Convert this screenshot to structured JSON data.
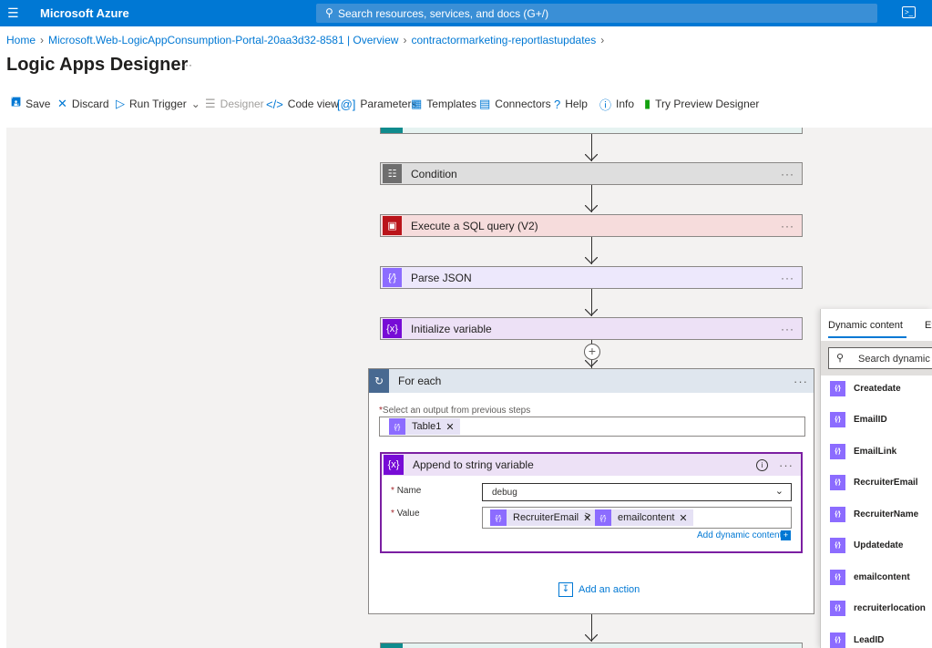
{
  "topbar": {
    "menu_icon": "hamburger-icon",
    "brand": "Microsoft Azure",
    "search_placeholder": "Search resources, services, and docs (G+/)",
    "cloud_shell_icon": "terminal-icon"
  },
  "breadcrumb": {
    "items": [
      "Home",
      "Microsoft.Web-LogicAppConsumption-Portal-20aa3d32-8581 | Overview",
      "contractormarketing-reportlastupdates"
    ]
  },
  "page": {
    "title": "Logic Apps Designer",
    "more": "···"
  },
  "toolbar": {
    "save": "Save",
    "discard": "Discard",
    "run_trigger": "Run Trigger",
    "designer": "Designer",
    "code_view": "Code view",
    "parameters": "Parameters",
    "templates": "Templates",
    "connectors": "Connectors",
    "help": "Help",
    "info": "Info",
    "try_preview": "Try Preview Designer"
  },
  "flow": {
    "steps": [
      {
        "title": "Condition",
        "color": "#6e6e6e",
        "bg": "#dedede"
      },
      {
        "title": "Execute a SQL query (V2)",
        "color": "#ba141a",
        "bg": "#f6dcdc"
      },
      {
        "title": "Parse JSON",
        "color": "#8c6cff",
        "bg": "#ede8fc"
      },
      {
        "title": "Initialize variable",
        "color": "#770bd6",
        "bg": "#ede1f6"
      }
    ],
    "more": "···"
  },
  "foreach": {
    "title": "For each",
    "select_label": "Select an output from previous steps",
    "token": "Table1",
    "append": {
      "title": "Append to string variable",
      "name_label": "Name",
      "name_value": "debug",
      "value_label": "Value",
      "token1": "RecruiterEmail",
      "separator": ">",
      "token2": "emailcontent",
      "add_dynamic": "Add dynamic content"
    },
    "add_action": "Add an action"
  },
  "dynamic": {
    "tab_active": "Dynamic content",
    "tab_other": "Ex",
    "search_placeholder": "Search dynamic co",
    "items": [
      "Createdate",
      "EmailID",
      "EmailLink",
      "RecruiterEmail",
      "RecruiterName",
      "Updatedate",
      "emailcontent",
      "recruiterlocation",
      "LeadID"
    ]
  },
  "colors": {
    "azure_blue": "#0078d4",
    "canvas_bg": "#f3f2f1",
    "selected_border": "#7b1fa2"
  }
}
